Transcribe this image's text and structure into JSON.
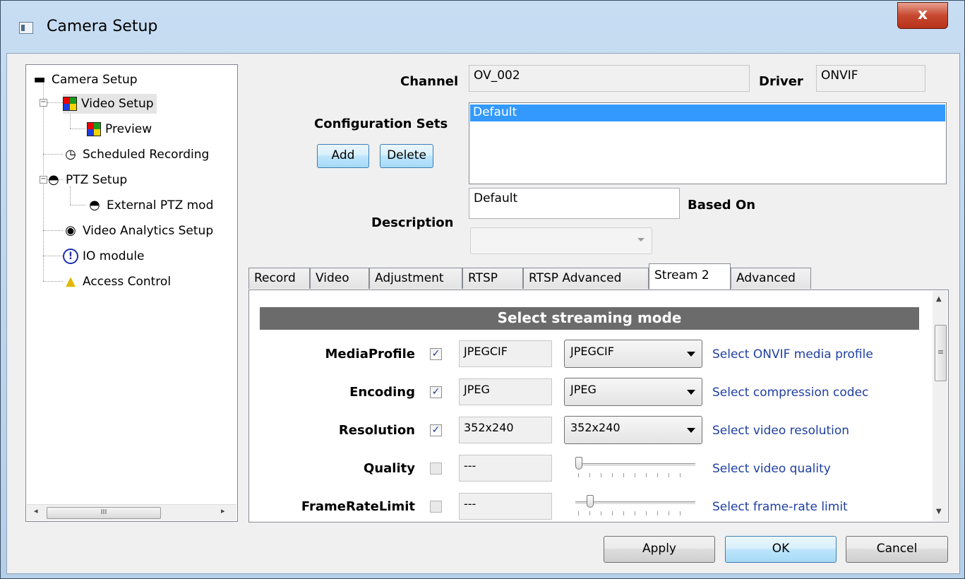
{
  "window": {
    "title": "Camera Setup",
    "close": "x"
  },
  "tree": {
    "items": [
      {
        "label": "Camera Setup"
      },
      {
        "label": "Video Setup"
      },
      {
        "label": "Preview"
      },
      {
        "label": "Scheduled Recording"
      },
      {
        "label": "PTZ Setup"
      },
      {
        "label": "External PTZ mod"
      },
      {
        "label": "Video Analytics Setup"
      },
      {
        "label": "IO module"
      },
      {
        "label": "Access Control"
      }
    ],
    "scroll_left": "◂",
    "scroll_right": "▸",
    "scroll_thumb": "III"
  },
  "header": {
    "channel_label": "Channel",
    "channel_value": "OV_002",
    "driver_label": "Driver",
    "driver_value": "ONVIF",
    "config_sets_label": "Configuration Sets",
    "add_label": "Add",
    "delete_label": "Delete",
    "config_sets": [
      "Default"
    ],
    "description_label": "Description",
    "description_value": "Default",
    "based_on_label": "Based On",
    "based_on_value": ""
  },
  "tabs": [
    "Record",
    "Video",
    "Adjustment",
    "RTSP",
    "RTSP Advanced",
    "Stream 2",
    "Advanced"
  ],
  "active_tab": "Stream 2",
  "panel": {
    "section_title": "Select streaming mode",
    "rows": [
      {
        "label": "MediaProfile",
        "checked": true,
        "value": "JPEGCIF",
        "control": "combo",
        "selected": "JPEGCIF",
        "desc": "Select ONVIF media profile"
      },
      {
        "label": "Encoding",
        "checked": true,
        "value": "JPEG",
        "control": "combo",
        "selected": "JPEG",
        "desc": "Select compression codec"
      },
      {
        "label": "Resolution",
        "checked": true,
        "value": "352x240",
        "control": "combo",
        "selected": "352x240",
        "desc": "Select video resolution"
      },
      {
        "label": "Quality",
        "checked": false,
        "value": "---",
        "control": "slider",
        "level": 0.0,
        "desc": "Select video quality"
      },
      {
        "label": "FrameRateLimit",
        "checked": false,
        "value": "---",
        "control": "slider",
        "level": 0.1,
        "desc": "Select frame-rate limit"
      }
    ],
    "check_mark": "✓",
    "scroll_up": "▲",
    "scroll_down": "▼",
    "scroll_grip": "≡"
  },
  "buttons": {
    "apply": "Apply",
    "ok": "OK",
    "cancel": "Cancel"
  }
}
